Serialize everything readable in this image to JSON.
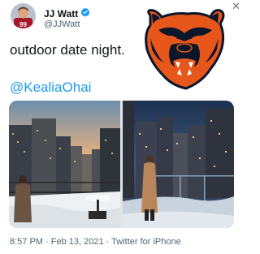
{
  "author": {
    "name": "JJ Watt",
    "handle": "@JJWatt",
    "jersey_number": "99",
    "verified_badge_color": "#1d9bf0"
  },
  "tweet": {
    "text": "outdoor date night.",
    "mention": "@KealiaOhai"
  },
  "media": {
    "count": 2
  },
  "footer": {
    "meta": "8:57 PM · Feb 13, 2021 · Twitter for iPhone"
  },
  "overlay": {
    "logo": "chicago-bears-logo",
    "close_icon": "close-icon",
    "logo_colors": {
      "orange": "#e7561b",
      "navy": "#0b162a"
    }
  },
  "colors": {
    "link": "#1d9bf0",
    "secondary_text": "#536471"
  }
}
